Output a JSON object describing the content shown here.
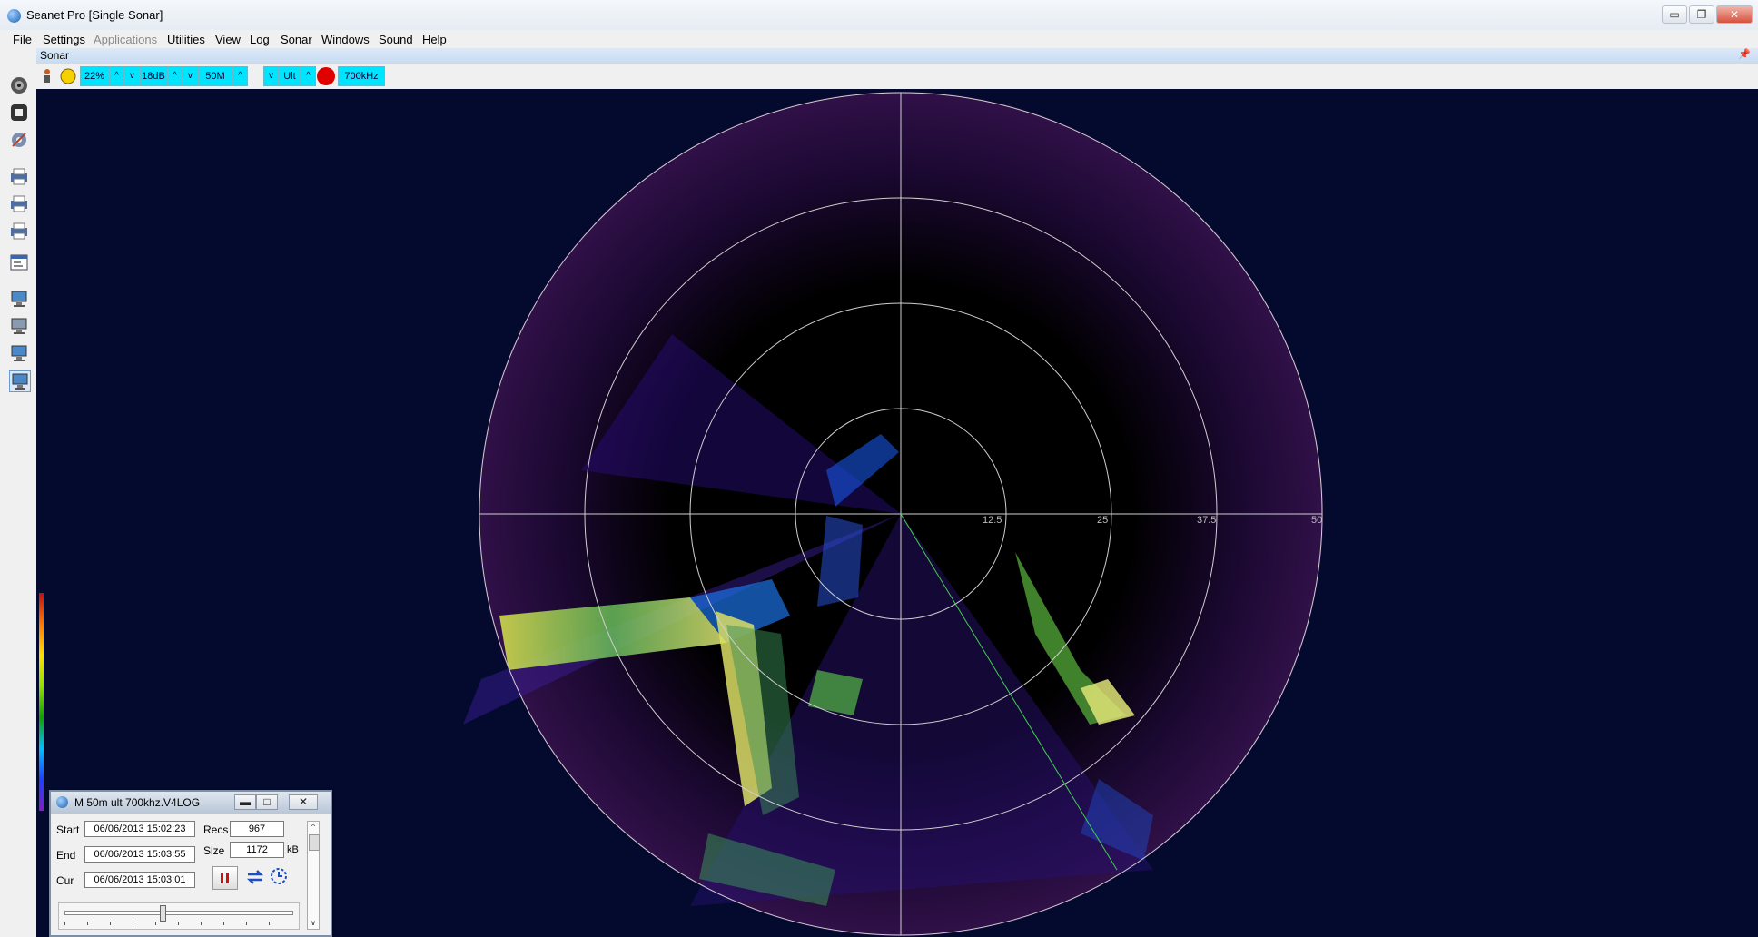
{
  "window": {
    "title": "Seanet Pro [Single Sonar]",
    "controls": {
      "minimize": "▭",
      "restore": "❐",
      "close": "✕"
    }
  },
  "menu": [
    "File",
    "Settings",
    "Applications",
    "Utilities",
    "View",
    "Log",
    "Sonar",
    "Windows",
    "Sound",
    "Help"
  ],
  "sonar_panel": {
    "header": "Sonar",
    "pin": "📌"
  },
  "toolbar": {
    "gain": "22%",
    "contrast": "18dB",
    "range": "50M",
    "mode": "Ult",
    "frequency": "700kHz",
    "up_arrow": "^",
    "down_arrow": "v",
    "record_color": "#e00000"
  },
  "display": {
    "range_labels": [
      "12.5",
      "25",
      "37.5",
      "50"
    ],
    "background": "#030a2e"
  },
  "playback": {
    "title": "M 50m ult 700khz.V4LOG",
    "start_label": "Start",
    "start_value": "06/06/2013 15:02:23",
    "end_label": "End",
    "end_value": "06/06/2013 15:03:55",
    "cur_label": "Cur",
    "cur_value": "06/06/2013 15:03:01",
    "recs_label": "Recs",
    "recs_value": "967",
    "size_label": "Size",
    "size_value": "1172",
    "size_unit": "kB",
    "slider_position": 0.42,
    "buttons": {
      "minimize": "▬",
      "maximize": "□",
      "close": "✕"
    }
  },
  "side_icons": [
    "target-icon",
    "stop-icon",
    "settings-icon",
    "printer-icon",
    "printer-icon",
    "printer-icon",
    "window-icon",
    "monitor-icon",
    "monitor-icon",
    "monitor-icon",
    "monitor-icon"
  ]
}
